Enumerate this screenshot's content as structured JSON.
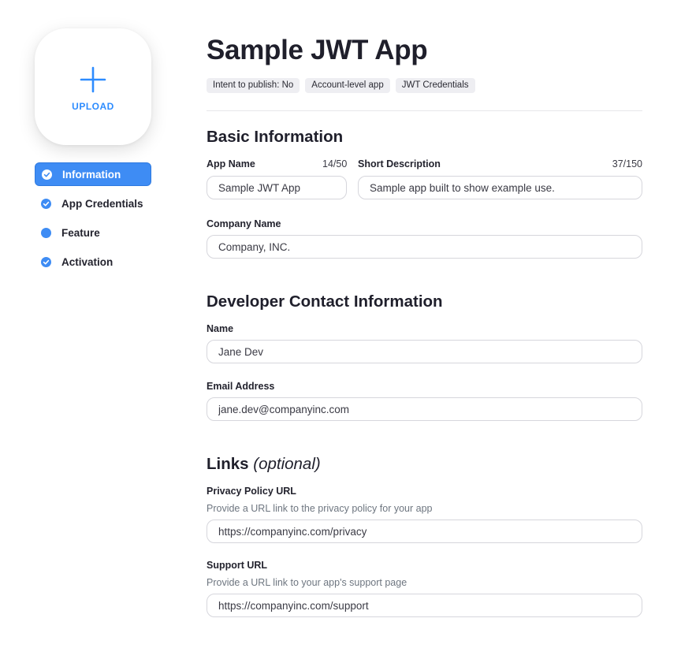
{
  "upload": {
    "label": "UPLOAD",
    "icon": "plus-icon",
    "accent": "#2d8cff"
  },
  "nav": {
    "items": [
      {
        "label": "Information",
        "icon": "check-circle-icon",
        "active": true
      },
      {
        "label": "App Credentials",
        "icon": "check-circle-icon",
        "active": false
      },
      {
        "label": "Feature",
        "icon": "dot-icon",
        "active": false
      },
      {
        "label": "Activation",
        "icon": "check-circle-icon",
        "active": false
      }
    ],
    "active_color": "#3e8cf4"
  },
  "app": {
    "title": "Sample JWT App",
    "tags": [
      "Intent to publish: No",
      "Account-level app",
      "JWT Credentials"
    ]
  },
  "basic": {
    "title": "Basic Information",
    "app_name": {
      "label": "App Name",
      "counter": "14/50",
      "value": "Sample JWT App"
    },
    "short_description": {
      "label": "Short Description",
      "counter": "37/150",
      "value": "Sample app built to show example use."
    },
    "company_name": {
      "label": "Company Name",
      "value": "Company, INC."
    }
  },
  "developer": {
    "title": "Developer Contact Information",
    "name": {
      "label": "Name",
      "value": "Jane Dev"
    },
    "email": {
      "label": "Email Address",
      "value": "jane.dev@companyinc.com"
    }
  },
  "links": {
    "title": "Links",
    "title_suffix": "(optional)",
    "privacy": {
      "label": "Privacy Policy URL",
      "help": "Provide a URL link to the privacy policy for your app",
      "value": "https://companyinc.com/privacy"
    },
    "support": {
      "label": "Support URL",
      "help": "Provide a URL link to your app's support page",
      "value": "https://companyinc.com/support"
    }
  }
}
